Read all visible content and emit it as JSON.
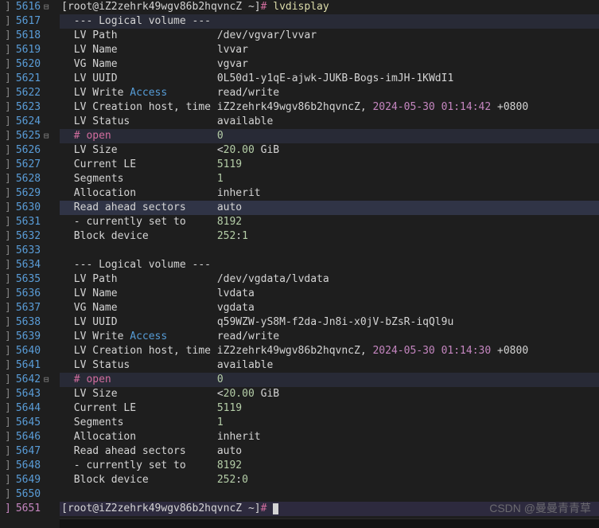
{
  "prompt1": {
    "userhost": "[root@iZ2zehrk49wgv86b2hqvncZ ~]",
    "hash": "# ",
    "cmd": "lvdisplay"
  },
  "prompt2": {
    "userhost": "[root@iZ2zehrk49wgv86b2hqvncZ ~]",
    "hash": "# "
  },
  "sep": "--- Logical volume ---",
  "watermark": "CSDN @曼曼青青草",
  "lines": {
    "5616": 5616,
    "5617": 5617,
    "5618": 5618,
    "5619": 5619,
    "5620": 5620,
    "5621": 5621,
    "5622": 5622,
    "5623": 5623,
    "5624": 5624,
    "5625": 5625,
    "5626": 5626,
    "5627": 5627,
    "5628": 5628,
    "5629": 5629,
    "5630": 5630,
    "5631": 5631,
    "5632": 5632,
    "5633": 5633,
    "5634": 5634,
    "5635": 5635,
    "5636": 5636,
    "5637": 5637,
    "5638": 5638,
    "5639": 5639,
    "5640": 5640,
    "5641": 5641,
    "5642": 5642,
    "5643": 5643,
    "5644": 5644,
    "5645": 5645,
    "5646": 5646,
    "5647": 5647,
    "5648": 5648,
    "5649": 5649,
    "5650": 5650,
    "5651": 5651
  },
  "vol1": {
    "path_lbl": "LV Path",
    "path": "/dev/vgvar/lvvar",
    "name_lbl": "LV Name",
    "name": "lvvar",
    "vg_lbl": "VG Name",
    "vg": "vgvar",
    "uuid_lbl": "LV UUID",
    "uuid_p1": "0L50d1",
    "uuid_p2": "y1qE",
    "uuid_p3": "ajwk",
    "uuid_p4": "JUKB",
    "uuid_p5": "Bogs",
    "uuid_p6": "imJH",
    "uuid_p7": "1KWdI1",
    "write_lbl": "LV Write ",
    "access_word": "Access",
    "write": "read/write",
    "creation_lbl": "LV Creation host, time iZ2zehrk49wgv86b2hqvncZ, ",
    "creation_date": "2024-05-30 01:14:42 ",
    "creation_tz": "+0800",
    "status_lbl": "LV Status",
    "status": "available",
    "open_lbl": "# open",
    "open": "0",
    "size_lbl": "LV Size",
    "size_lt": "<",
    "size_num": "20.00",
    "size_unit": " GiB",
    "curle_lbl": "Current LE",
    "curle": "5119",
    "seg_lbl": "Segments",
    "seg": "1",
    "alloc_lbl": "Allocation",
    "alloc": "inherit",
    "ras_lbl": "Read ahead sectors",
    "ras": "auto",
    "cur_lbl": "- currently set to",
    "cur": "8192",
    "blk_lbl": "Block device",
    "blk_major": "252",
    "blk_minor": "1"
  },
  "vol2": {
    "path_lbl": "LV Path",
    "path": "/dev/vgdata/lvdata",
    "name_lbl": "LV Name",
    "name": "lvdata",
    "vg_lbl": "VG Name",
    "vg": "vgdata",
    "uuid_lbl": "LV UUID",
    "uuid_p1": "q59WZW",
    "uuid_p2": "yS8M",
    "uuid_p3": "f2da",
    "uuid_p4": "Jn8i",
    "uuid_p5": "x0jV",
    "uuid_p6": "bZsR",
    "uuid_p7": "iqQl9u",
    "write_lbl": "LV Write ",
    "access_word": "Access",
    "write": "read/write",
    "creation_lbl": "LV Creation host, time iZ2zehrk49wgv86b2hqvncZ, ",
    "creation_date": "2024-05-30 01:14:30 ",
    "creation_tz": "+0800",
    "status_lbl": "LV Status",
    "status": "available",
    "open_lbl": "# open",
    "open": "0",
    "size_lbl": "LV Size",
    "size_lt": "<",
    "size_num": "20.00",
    "size_unit": " GiB",
    "curle_lbl": "Current LE",
    "curle": "5119",
    "seg_lbl": "Segments",
    "seg": "1",
    "alloc_lbl": "Allocation",
    "alloc": "inherit",
    "ras_lbl": "Read ahead sectors",
    "ras": "auto",
    "cur_lbl": "- currently set to",
    "cur": "8192",
    "blk_lbl": "Block device",
    "blk_major": "252",
    "blk_minor": "0"
  }
}
